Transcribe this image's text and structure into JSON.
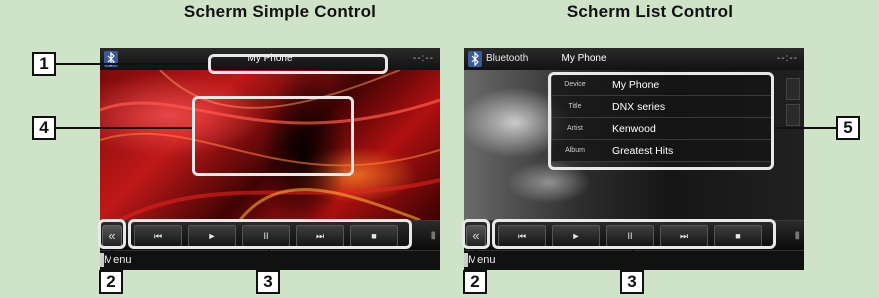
{
  "headings": {
    "simple": "Scherm Simple Control",
    "list": "Scherm List Control"
  },
  "simple_screen": {
    "source": "Bluetooth",
    "title": "My Phone",
    "clock": "--:--",
    "controls": {
      "back": "«",
      "prev": "⏮",
      "play": "►",
      "pause": "II",
      "next": "⏭",
      "stop": "■"
    },
    "menu": "Menu"
  },
  "list_screen": {
    "source": "Bluetooth",
    "title": "My Phone",
    "clock": "--:--",
    "info": [
      {
        "label": "Device",
        "value": "My Phone"
      },
      {
        "label": "Title",
        "value": "DNX series"
      },
      {
        "label": "Artist",
        "value": "Kenwood"
      },
      {
        "label": "Album",
        "value": "Greatest Hits"
      }
    ],
    "controls": {
      "back": "«",
      "prev": "⏮",
      "play": "►",
      "pause": "II",
      "next": "⏭",
      "stop": "■"
    },
    "menu": "Menu"
  },
  "callouts": {
    "c1": "1",
    "c2a": "2",
    "c2b": "2",
    "c3a": "3",
    "c3b": "3",
    "c4": "4",
    "c5": "5"
  },
  "colors": {
    "background": "#cfe3c9",
    "highlight": "#e8e8e8",
    "art_red": "#c01818"
  }
}
